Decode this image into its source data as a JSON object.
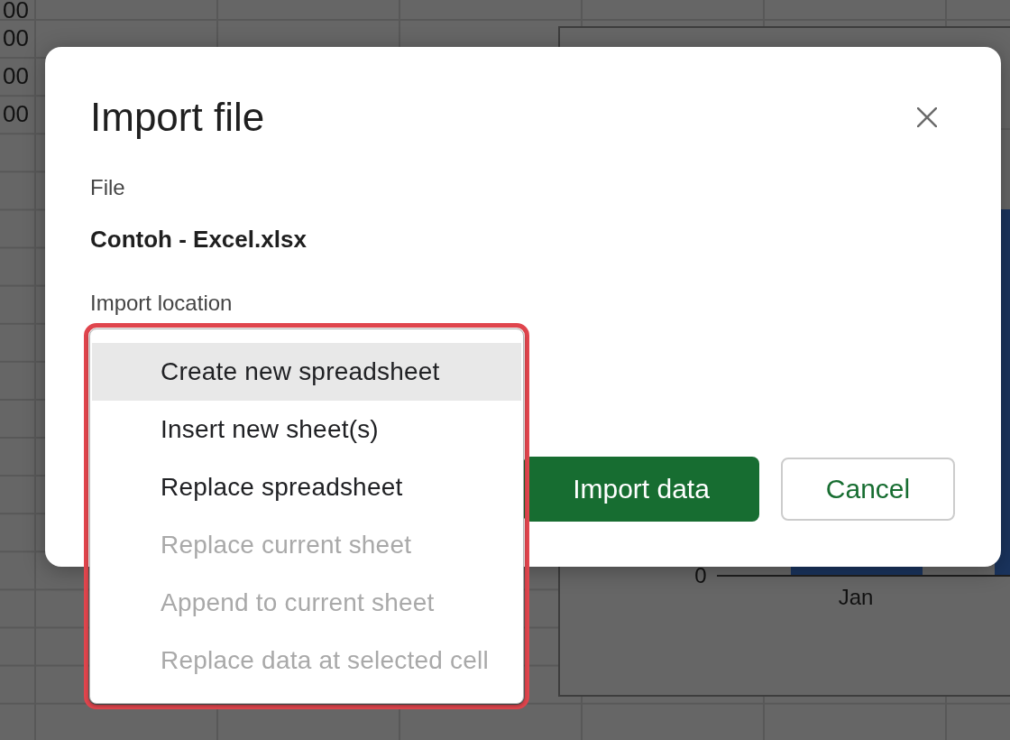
{
  "spreadsheet": {
    "column_1_values": [
      "00",
      "00",
      "00",
      "00"
    ]
  },
  "chart": {
    "y_tick_label": "0",
    "x_category_label": "Jan"
  },
  "dialog": {
    "title": "Import file",
    "file_label": "File",
    "file_name": "Contoh - Excel.xlsx",
    "location_label": "Import location",
    "location_menu": [
      {
        "label": "Create new spreadsheet",
        "selected": true,
        "disabled": false
      },
      {
        "label": "Insert new sheet(s)",
        "selected": false,
        "disabled": false
      },
      {
        "label": "Replace spreadsheet",
        "selected": false,
        "disabled": false
      },
      {
        "label": "Replace current sheet",
        "selected": false,
        "disabled": true
      },
      {
        "label": "Append to current sheet",
        "selected": false,
        "disabled": true
      },
      {
        "label": "Replace data at selected cell",
        "selected": false,
        "disabled": true
      }
    ],
    "buttons": [
      {
        "label": "Import data",
        "kind": "primary"
      },
      {
        "label": "Cancel",
        "kind": "secondary"
      }
    ]
  }
}
